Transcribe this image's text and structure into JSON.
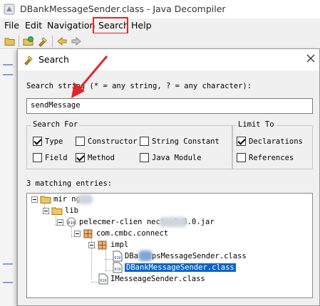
{
  "window": {
    "title": "DBankMessageSender.class - Java Decompiler",
    "app_icon": "java-decompiler-icon"
  },
  "menubar": {
    "items": [
      "File",
      "Edit",
      "Navigation",
      "Search",
      "Help"
    ]
  },
  "annotation": {
    "highlight_color": "#e0262b",
    "highlighted_menu": "Search"
  },
  "toolbar": {
    "icons": [
      "open-folder-icon",
      "open-type-icon",
      "search-flashlight-icon",
      "back-arrow-icon",
      "forward-arrow-icon"
    ]
  },
  "dialog": {
    "title": "Search",
    "search_label": "Search string (* = any string, ? = any character):",
    "search_value": "sendMessage",
    "search_for": {
      "title": "Search For",
      "options": [
        {
          "label": "Type",
          "checked": true
        },
        {
          "label": "Constructor",
          "checked": false
        },
        {
          "label": "String Constant",
          "checked": false
        },
        {
          "label": "Field",
          "checked": false
        },
        {
          "label": "Method",
          "checked": true
        },
        {
          "label": "Java Module",
          "checked": false
        }
      ]
    },
    "limit_to": {
      "title": "Limit To",
      "options": [
        {
          "label": "Declarations",
          "checked": true
        },
        {
          "label": "References",
          "checked": false
        }
      ]
    },
    "matching_label": "3 matching entries:",
    "tree": [
      {
        "label": "mir    ng",
        "icon": "folder-icon"
      },
      {
        "label": "lib",
        "icon": "folder-icon"
      },
      {
        "label": "pelecmer-clien      nect-v1.3.0.jar",
        "icon": "jar-icon"
      },
      {
        "label": "com.cmbc.connect",
        "icon": "package-icon"
      },
      {
        "label": "impl",
        "icon": "package-icon"
      },
      {
        "label": "DBa     ttpsMessageSender.class",
        "icon": "class-file-icon"
      },
      {
        "label": "DBankMessageSender.class",
        "icon": "class-file-icon",
        "selected": true
      },
      {
        "label": "IMesseageSender.class",
        "icon": "class-file-icon"
      }
    ],
    "file_badge": "010"
  }
}
